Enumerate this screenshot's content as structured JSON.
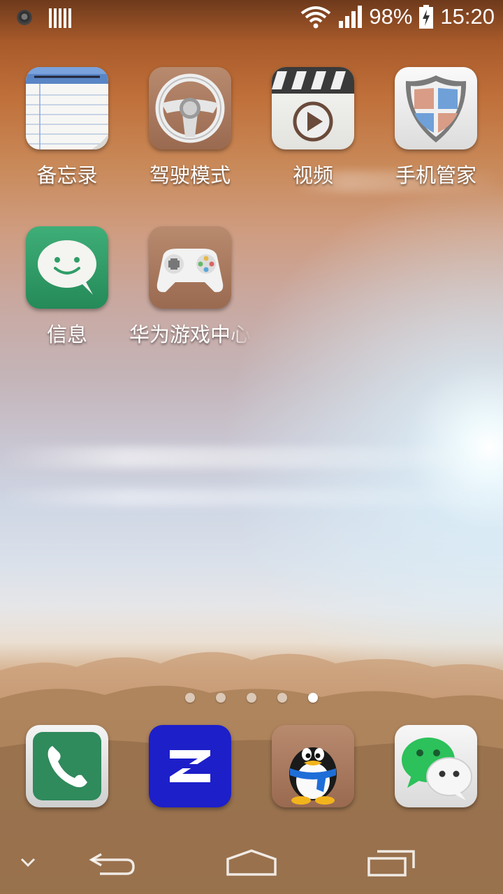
{
  "status_bar": {
    "battery_percent": "98%",
    "time": "15:20",
    "icons": [
      "camera-indicator-icon",
      "sim-card-icon",
      "wifi-icon",
      "signal-icon",
      "battery-charging-icon"
    ]
  },
  "home_apps": [
    {
      "label": "备忘录",
      "icon": "notepad-icon"
    },
    {
      "label": "驾驶模式",
      "icon": "steering-wheel-icon"
    },
    {
      "label": "视频",
      "icon": "video-clapper-icon"
    },
    {
      "label": "手机管家",
      "icon": "shield-icon"
    },
    {
      "label": "信息",
      "icon": "message-bubble-icon"
    },
    {
      "label": "华为游戏中心",
      "icon": "gamepad-icon"
    }
  ],
  "pages": {
    "count": 5,
    "active_index": 4
  },
  "dock": [
    {
      "icon": "phone-icon"
    },
    {
      "icon": "z-app-icon"
    },
    {
      "icon": "qq-penguin-icon"
    },
    {
      "icon": "wechat-icon"
    }
  ],
  "nav": {
    "icons": [
      "chevron-down-icon",
      "back-icon",
      "home-icon",
      "recents-icon"
    ]
  },
  "colors": {
    "wechat_green": "#2cc15a",
    "messages_green": "#2f9e68",
    "z_blue": "#1d1fc9"
  }
}
